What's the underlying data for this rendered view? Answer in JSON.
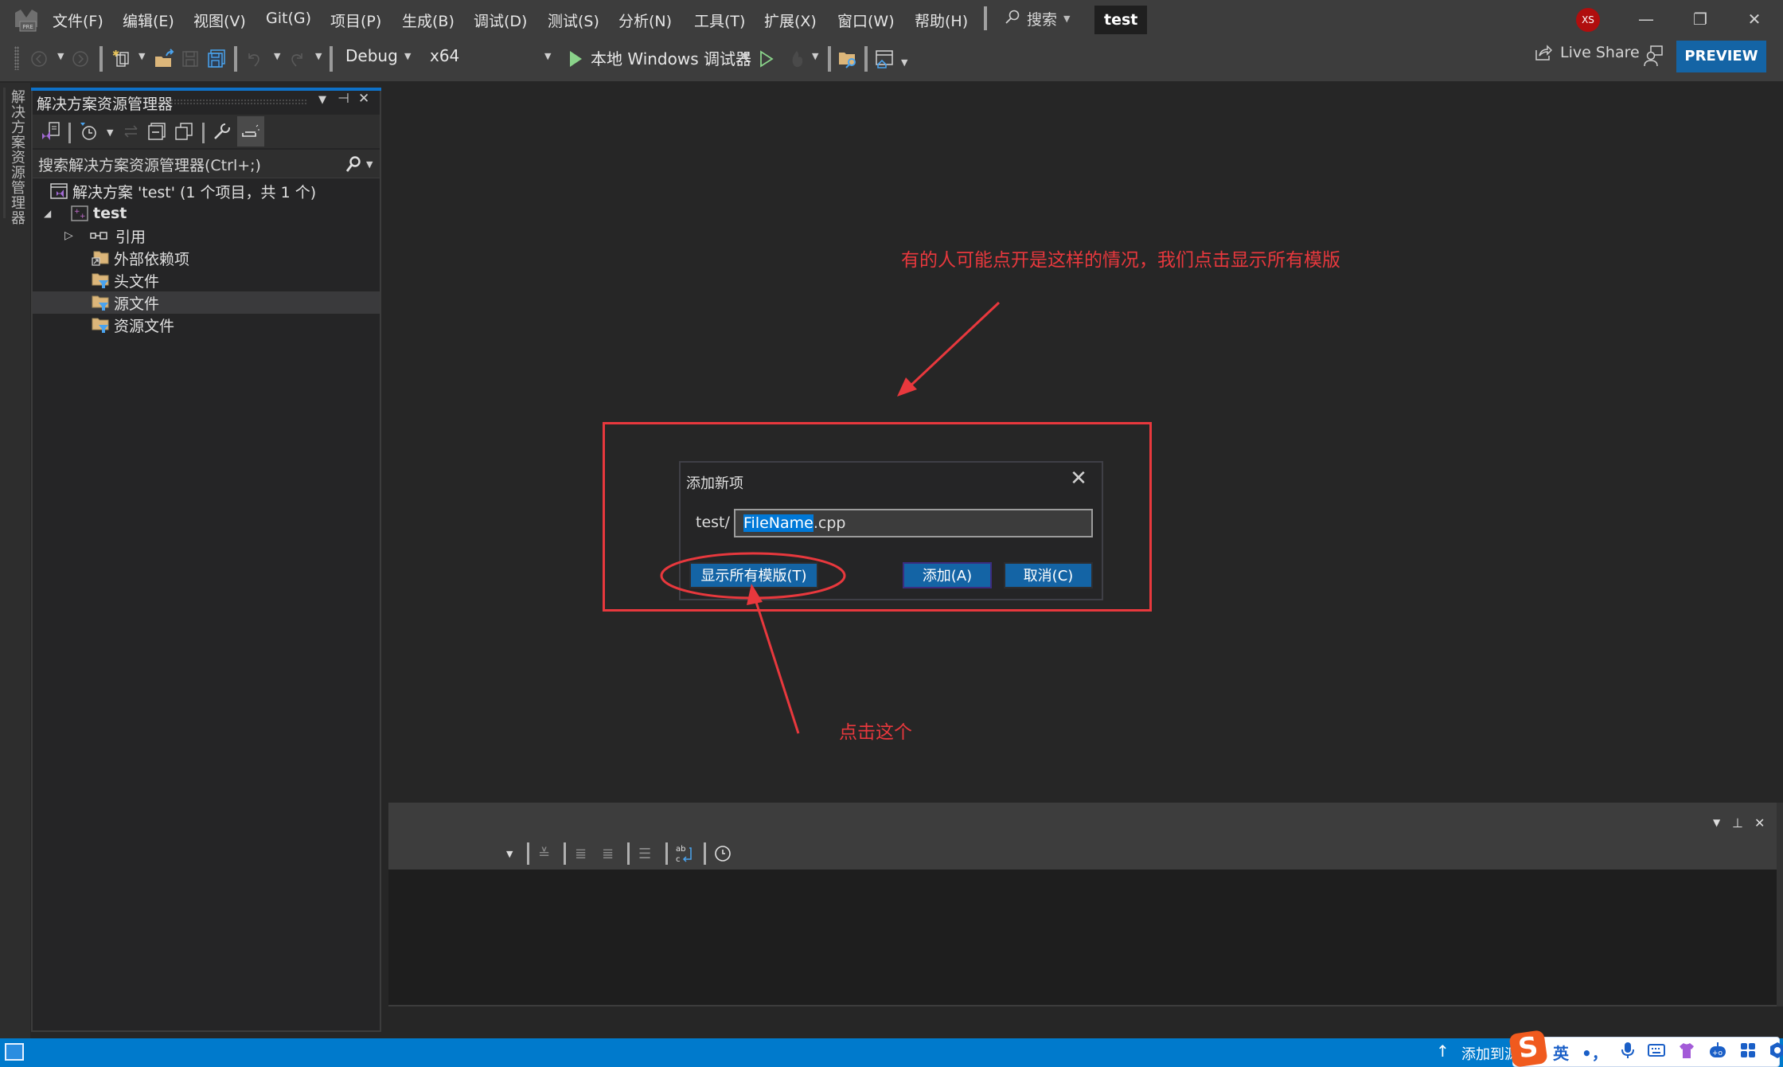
{
  "menubar": {
    "items": [
      "文件(F)",
      "编辑(E)",
      "视图(V)",
      "Git(G)",
      "项目(P)",
      "生成(B)",
      "调试(D)",
      "测试(S)",
      "分析(N)",
      "工具(T)",
      "扩展(X)",
      "窗口(W)",
      "帮助(H)"
    ],
    "search_label": "搜索",
    "solution_title": "test",
    "avatar_initials": "XS",
    "window_buttons": {
      "minimize": "—",
      "restore": "❐",
      "close": "✕"
    }
  },
  "toolbar": {
    "configuration": "Debug",
    "platform": "x64",
    "debugger": "本地 Windows 调试器",
    "live_share": "Live Share",
    "preview": "PREVIEW"
  },
  "sidebar_tab": {
    "label": "解决方案资源管理器"
  },
  "solution_explorer": {
    "title": "解决方案资源管理器",
    "search_placeholder": "搜索解决方案资源管理器(Ctrl+;)",
    "tree": [
      {
        "label": "解决方案 'test' (1 个项目，共 1 个)",
        "icon": "solution-icon",
        "level": 0
      },
      {
        "label": "test",
        "icon": "cpp-project-icon",
        "level": 1,
        "expanded": true
      },
      {
        "label": "引用",
        "icon": "references-icon",
        "level": 2,
        "collapsed": true
      },
      {
        "label": "外部依赖项",
        "icon": "external-deps-icon",
        "level": 2
      },
      {
        "label": "头文件",
        "icon": "filter-folder-icon",
        "level": 2
      },
      {
        "label": "源文件",
        "icon": "filter-folder-icon",
        "level": 2,
        "selected": true
      },
      {
        "label": "资源文件",
        "icon": "filter-folder-icon",
        "level": 2
      }
    ]
  },
  "annotations": {
    "top_text": "有的人可能点开是这样的情况，我们点击显示所有模版",
    "bottom_text": "点击这个",
    "color": "#e8383d"
  },
  "dialog": {
    "title": "添加新项",
    "path_prefix": "test/",
    "filename_selected": "FileName",
    "filename_ext": ".cpp",
    "show_all_templates": "显示所有模版(T)",
    "add": "添加(A)",
    "cancel": "取消(C)"
  },
  "statusbar": {
    "publish_label": "添加到源",
    "ime": {
      "logo": "S",
      "lang": "英",
      "punct": "•，"
    }
  },
  "colors": {
    "accent": "#007acc",
    "button_blue": "#1464a5",
    "annotation_red": "#e8383d",
    "avatar_red": "#b00e0e"
  }
}
